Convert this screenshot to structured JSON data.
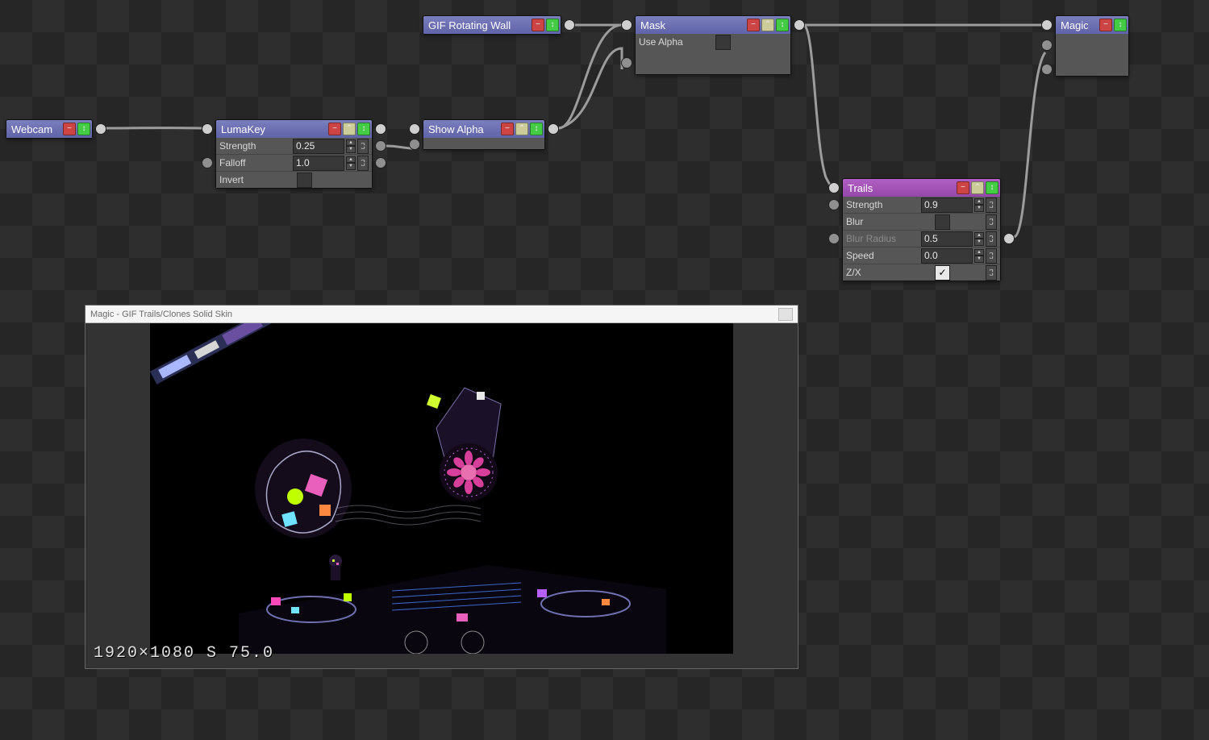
{
  "nodes": {
    "webcam": {
      "title": "Webcam"
    },
    "lumakey": {
      "title": "LumaKey",
      "params": {
        "strength_label": "Strength",
        "strength_val": "0.25",
        "falloff_label": "Falloff",
        "falloff_val": "1.0",
        "invert_label": "Invert",
        "invert_checked": false
      }
    },
    "showalpha": {
      "title": "Show Alpha"
    },
    "gifwall": {
      "title": "GIF Rotating Wall"
    },
    "mask": {
      "title": "Mask",
      "use_alpha_label": "Use Alpha",
      "use_alpha_checked": false
    },
    "trails": {
      "title": "Trails",
      "params": {
        "strength_label": "Strength",
        "strength_val": "0.9",
        "blur_label": "Blur",
        "blur_checked": false,
        "blurrad_label": "Blur Radius",
        "blurrad_val": "0.5",
        "speed_label": "Speed",
        "speed_val": "0.0",
        "zx_label": "Z/X",
        "zx_checked": true
      }
    },
    "magic": {
      "title": "Magic"
    }
  },
  "preview": {
    "title": "Magic - GIF Trails/Clones Solid Skin",
    "osd": "1920×1080  S  75.0"
  }
}
